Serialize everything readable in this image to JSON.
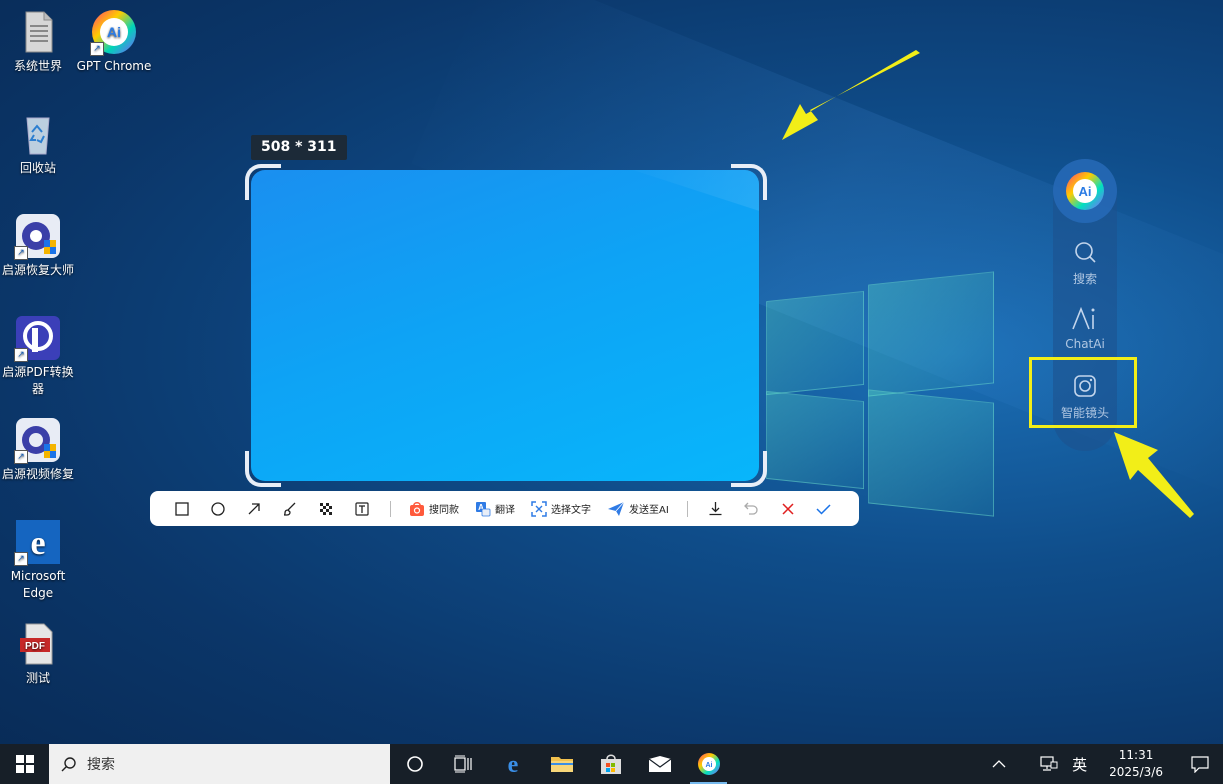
{
  "desktop": {
    "icons": [
      {
        "label": "系统世界"
      },
      {
        "label": "GPT Chrome"
      },
      {
        "label": "回收站"
      },
      {
        "label": "启源恢复大师"
      },
      {
        "label": "启源PDF转换器"
      },
      {
        "label": "启源视频修复"
      },
      {
        "label": "Microsoft Edge"
      },
      {
        "label": "测试"
      }
    ]
  },
  "screenshot_tool": {
    "size_label": "508 * 311",
    "selection": {
      "width": 508,
      "height": 311
    },
    "toolbar": {
      "tools": [
        {
          "name": "rectangle-tool",
          "icon": "square-icon"
        },
        {
          "name": "ellipse-tool",
          "icon": "circle-icon"
        },
        {
          "name": "arrow-tool",
          "icon": "arrow-icon"
        },
        {
          "name": "brush-tool",
          "icon": "brush-icon"
        },
        {
          "name": "mosaic-tool",
          "icon": "mosaic-icon"
        },
        {
          "name": "text-tool",
          "icon": "text-icon"
        }
      ],
      "search_same": "搜同款",
      "translate": "翻译",
      "select_text": "选择文字",
      "send_to_ai": "发送至AI",
      "actions": [
        {
          "name": "download",
          "icon": "download-icon"
        },
        {
          "name": "undo",
          "icon": "undo-icon"
        },
        {
          "name": "cancel",
          "icon": "close-icon"
        },
        {
          "name": "confirm",
          "icon": "check-icon"
        }
      ]
    }
  },
  "side_panel": {
    "logo": "Ai",
    "items": [
      {
        "label": "搜索",
        "icon": "search-icon"
      },
      {
        "label": "ChatAi",
        "icon": "ai-icon"
      },
      {
        "label": "智能镜头",
        "icon": "camera-icon"
      }
    ],
    "highlight_color": "#f2ee18"
  },
  "taskbar": {
    "search_placeholder": "搜索",
    "ime": "英",
    "time": "11:31",
    "date": "2025/3/6"
  },
  "colors": {
    "accent_yellow": "#f2ee18",
    "selection_blue": "#0ea3f5",
    "taskbar_bg": "#171f28",
    "cancel_red": "#e02020",
    "confirm_blue": "#1a73e8"
  }
}
